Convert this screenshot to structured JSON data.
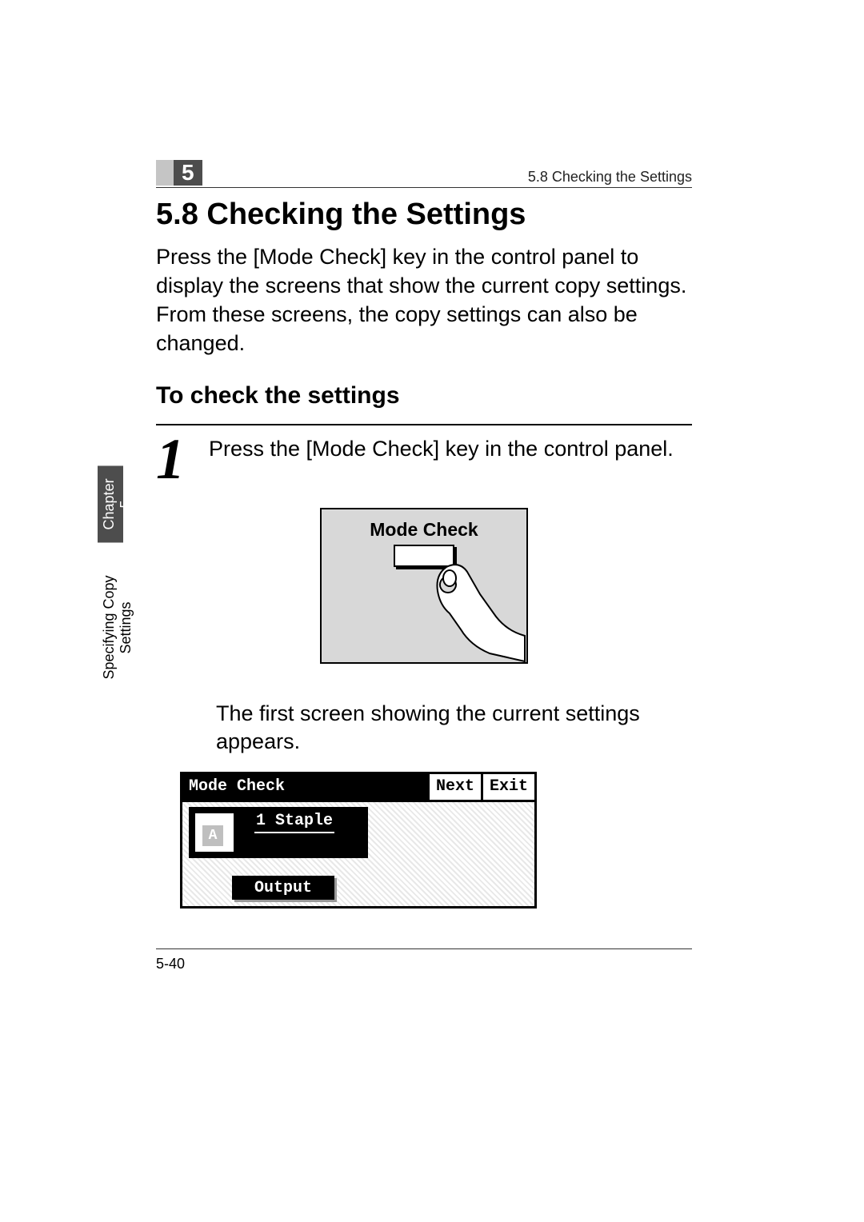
{
  "header": {
    "chapter_number": "5",
    "running_head": "5.8 Checking the Settings"
  },
  "section": {
    "title": "5.8  Checking the Settings",
    "intro": "Press the [Mode Check] key in the control panel to display the screens that show the current copy settings. From these screens, the copy settings can also be changed.",
    "subtitle": "To check the settings"
  },
  "step1": {
    "number": "1",
    "text": "Press the [Mode Check] key in the control panel.",
    "panel_label": "Mode Check",
    "result": "The first screen showing the current settings appears."
  },
  "lcd": {
    "title": "Mode Check",
    "next": "Next",
    "exit": "Exit",
    "staple": "1 Staple",
    "doc_letter": "A",
    "output": "Output"
  },
  "side_tab": {
    "chapter": "Chapter 5",
    "label": "Specifying Copy Settings"
  },
  "footer": {
    "page": "5-40"
  }
}
